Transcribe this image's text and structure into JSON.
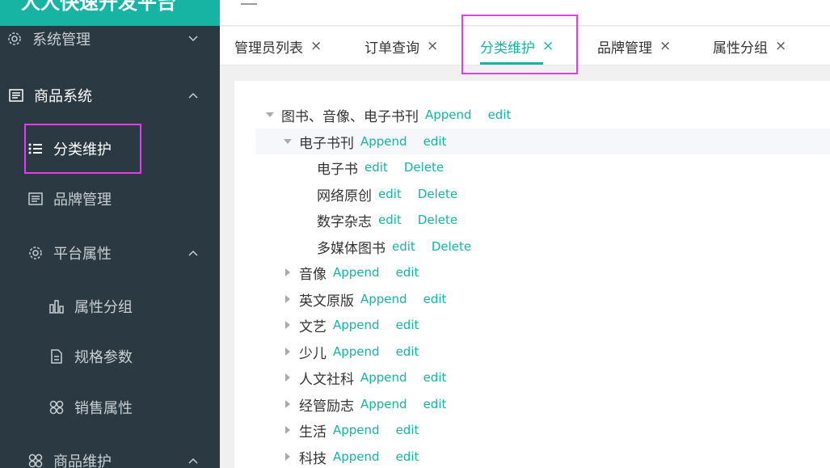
{
  "brand": {
    "title": "人人快速开发平台"
  },
  "sidebar": {
    "items": [
      {
        "label": "系统管理"
      },
      {
        "label": "商品系统"
      },
      {
        "label": "分类维护"
      },
      {
        "label": "品牌管理"
      },
      {
        "label": "平台属性"
      },
      {
        "label": "属性分组"
      },
      {
        "label": "规格参数"
      },
      {
        "label": "销售属性"
      },
      {
        "label": "商品维护"
      }
    ]
  },
  "tabs": [
    {
      "label": "管理员列表",
      "close": "×"
    },
    {
      "label": "订单查询",
      "close": "×"
    },
    {
      "label": "分类维护",
      "close": "×"
    },
    {
      "label": "品牌管理",
      "close": "×"
    },
    {
      "label": "属性分组",
      "close": "×"
    }
  ],
  "tree": {
    "append_label": "Append",
    "edit_label": "edit",
    "delete_label": "Delete",
    "nodes": [
      {
        "label": "图书、音像、电子书刊"
      },
      {
        "label": "电子书刊"
      },
      {
        "label": "电子书"
      },
      {
        "label": "网络原创"
      },
      {
        "label": "数字杂志"
      },
      {
        "label": "多媒体图书"
      },
      {
        "label": "音像"
      },
      {
        "label": "英文原版"
      },
      {
        "label": "文艺"
      },
      {
        "label": "少儿"
      },
      {
        "label": "人文社科"
      },
      {
        "label": "经管励志"
      },
      {
        "label": "生活"
      },
      {
        "label": "科技"
      }
    ]
  },
  "colors": {
    "accent": "#17b3a3",
    "sidebar_bg": "#2b3a42",
    "highlight": "#e13ee8"
  }
}
